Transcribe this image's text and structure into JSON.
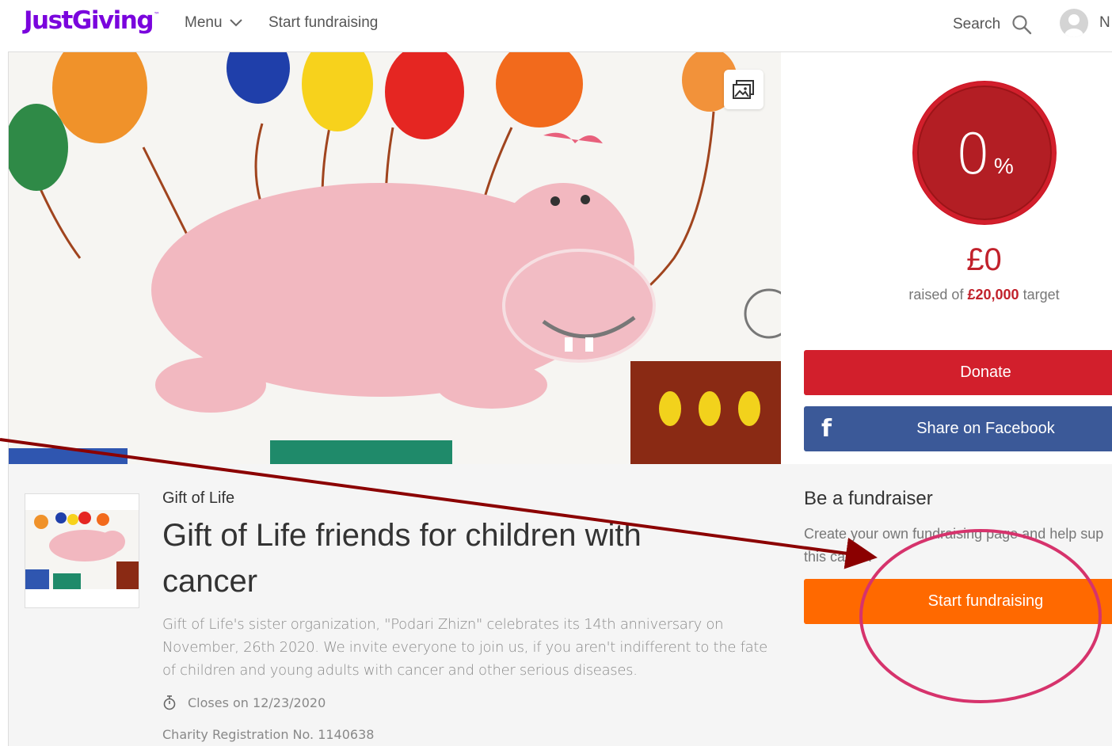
{
  "header": {
    "logo": "JustGiving",
    "logo_mark": "™",
    "menu_label": "Menu",
    "start_fundraising_label": "Start fundraising",
    "search_label": "Search",
    "user_initial": "N"
  },
  "sidebar": {
    "progress_value": "0",
    "progress_unit": "%",
    "progress_percent": 0,
    "raised_amount": "£0",
    "raised_prefix": "raised of",
    "target_amount": "£20,000",
    "target_suffix": "target",
    "donate_label": "Donate",
    "facebook_icon": "f",
    "facebook_label": "Share on Facebook"
  },
  "page": {
    "charity_name": "Gift of Life",
    "title": "Gift of Life friends for children with cancer",
    "description": "Gift of Life's sister organization, \"Podari Zhizn\" celebrates its 14th anniversary on November, 26th 2020. We invite everyone to join us, if you aren't indifferent to the fate of children and young adults with cancer and other serious diseases.",
    "closes": "Closes on 12/23/2020",
    "charity_reg": "Charity Registration No. 1140638"
  },
  "fundraiser": {
    "title": "Be a fundraiser",
    "text_line1": "Create your own fundraising page and help sup",
    "text_line2": "this cause.",
    "button_label": "Start fundraising"
  },
  "annotation": {
    "arrow_color": "#8b0000",
    "circle_color": "#d6336c"
  },
  "colors": {
    "brand": "#7a04dd",
    "donate": "#d21f2c",
    "facebook": "#3b5998",
    "start": "#ff6900"
  }
}
